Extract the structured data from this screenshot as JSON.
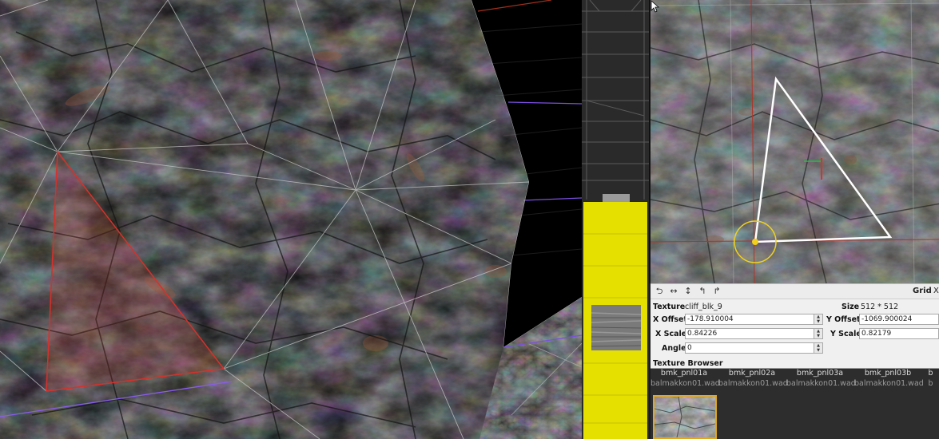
{
  "toolbar": {
    "icons": [
      "rotate-left-icon",
      "flip-horizontal-icon",
      "flip-vertical-icon",
      "rotate-ccw-icon",
      "rotate-cw-icon"
    ],
    "glyphs": [
      "⮌",
      "↔",
      "↕",
      "↰",
      "↱"
    ],
    "grid_label": "Grid",
    "grid_x_label": "X:"
  },
  "texture_props": {
    "texture_label": "Texture",
    "texture_value": "cliff_blk_9",
    "size_label": "Size",
    "size_value": "512 * 512",
    "x_offset_label": "X Offset",
    "x_offset_value": "-178.910004",
    "y_offset_label": "Y Offset",
    "y_offset_value": "-1069.900024",
    "x_scale_label": "X Scale",
    "x_scale_value": "0.84226",
    "y_scale_label": "Y Scale",
    "y_scale_value": "0.82179",
    "angle_label": "Angle",
    "angle_value": "0"
  },
  "browser": {
    "title": "Texture Browser",
    "items": [
      {
        "name": "bmk_pnl01a",
        "wad": "balmakkon01.wad"
      },
      {
        "name": "bmk_pnl02a",
        "wad": "balmakkon01.wad"
      },
      {
        "name": "bmk_pnl03a",
        "wad": "balmakkon01.wad"
      },
      {
        "name": "bmk_pnl03b",
        "wad": "balmakkon01.wad"
      },
      {
        "name": "b",
        "wad": "b"
      }
    ]
  },
  "colors": {
    "highlight_yellow": "#e6e000",
    "selection_red": "#d8302a",
    "uv_white": "#ffffff",
    "handle_yellow": "#f2d21b",
    "thumb_border": "#e0a820",
    "purple_line": "#8a5cf0"
  }
}
